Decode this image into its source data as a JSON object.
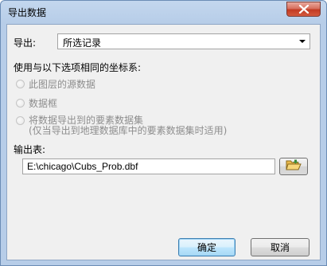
{
  "window": {
    "title": "导出数据",
    "close_icon": "close-icon"
  },
  "export": {
    "label": "导出:",
    "selected": "所选记录"
  },
  "coord": {
    "heading": "使用与以下选项相同的坐标系:",
    "options": [
      {
        "label": "此图层的源数据",
        "enabled": false,
        "checked": false
      },
      {
        "label": "数据框",
        "enabled": false,
        "checked": false
      },
      {
        "label": "将数据导出到的要素数据集",
        "enabled": false,
        "checked": false
      }
    ],
    "option3_note": "(仅当导出到地理数据库中的要素数据集时适用)"
  },
  "output": {
    "label": "输出表:",
    "path": "E:\\chicago\\Cubs_Prob.dbf",
    "browse_icon": "open-folder-icon"
  },
  "buttons": {
    "ok": "确定",
    "cancel": "取消"
  },
  "colors": {
    "title_bar": "#b7cde8",
    "client": "#f0f0f0",
    "close_button": "#c23a22",
    "disabled_text": "#8d8d8d"
  }
}
